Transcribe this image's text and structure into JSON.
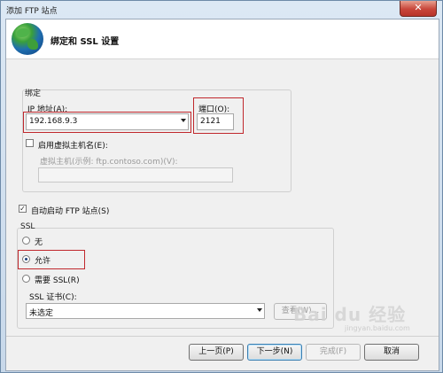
{
  "window": {
    "title": "添加 FTP 站点",
    "close_glyph": "✕"
  },
  "header": {
    "title": "绑定和 SSL 设置",
    "icon": "globe-icon"
  },
  "binding": {
    "legend": "绑定",
    "ip_label": "IP 地址(A):",
    "ip_value": "192.168.9.3",
    "port_label": "端口(O):",
    "port_value": "2121",
    "enable_virtual_host_label": "启用虚拟主机名(E):",
    "enable_virtual_host_checked": false,
    "virtual_host_label": "虚拟主机(示例: ftp.contoso.com)(V):",
    "virtual_host_value": ""
  },
  "auto_start": {
    "label": "自动启动 FTP 站点(S)",
    "checked": true
  },
  "ssl": {
    "legend": "SSL",
    "options": [
      "无",
      "允许",
      "需要 SSL(R)"
    ],
    "selected": "允许",
    "cert_label": "SSL 证书(C):",
    "cert_value": "未选定",
    "view_button": "查看(W)..."
  },
  "footer": {
    "prev": "上一页(P)",
    "next": "下一步(N)",
    "finish": "完成(F)",
    "cancel": "取消"
  },
  "watermark": {
    "text": "Bai du 经验",
    "sub": "jingyan.baidu.com"
  },
  "colors": {
    "highlight_border": "#c0282d",
    "title_bar": "#c7d8ea"
  }
}
